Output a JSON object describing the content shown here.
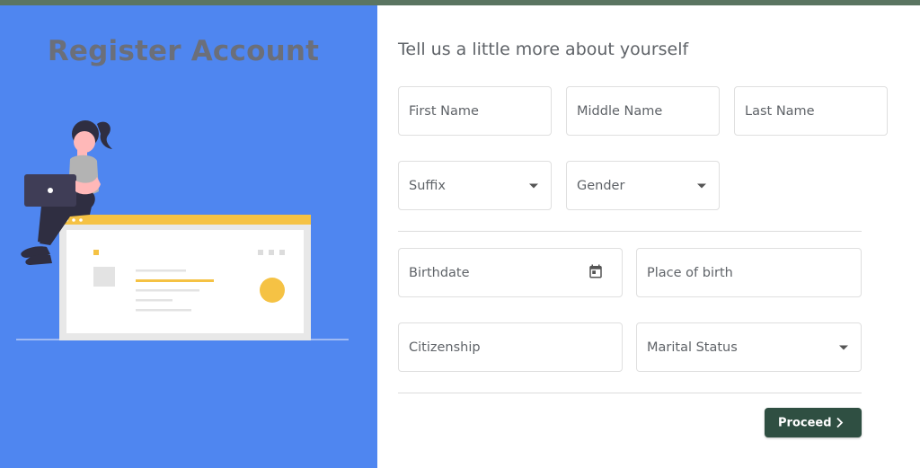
{
  "colors": {
    "top_bar": "#5b7561",
    "left_bg": "#4f86f0",
    "title_text": "#6b6f7a",
    "heading_text": "#5f6368",
    "accent_yellow": "#f5c244",
    "button_bg": "#2f4f42",
    "divider": "#dcdcdc"
  },
  "left": {
    "title": "Register Account"
  },
  "form": {
    "heading": "Tell us a little more about yourself",
    "fields": {
      "first_name": "First Name",
      "middle_name": "Middle Name",
      "last_name": "Last Name",
      "suffix": "Suffix",
      "gender": "Gender",
      "birthdate": "Birthdate",
      "place_of_birth": "Place of birth",
      "citizenship": "Citizenship",
      "marital_status": "Marital Status"
    },
    "icons": {
      "select": "chevron-down-icon",
      "date": "calendar-icon",
      "proceed": "chevron-right-icon"
    },
    "proceed_label": "Proceed"
  }
}
